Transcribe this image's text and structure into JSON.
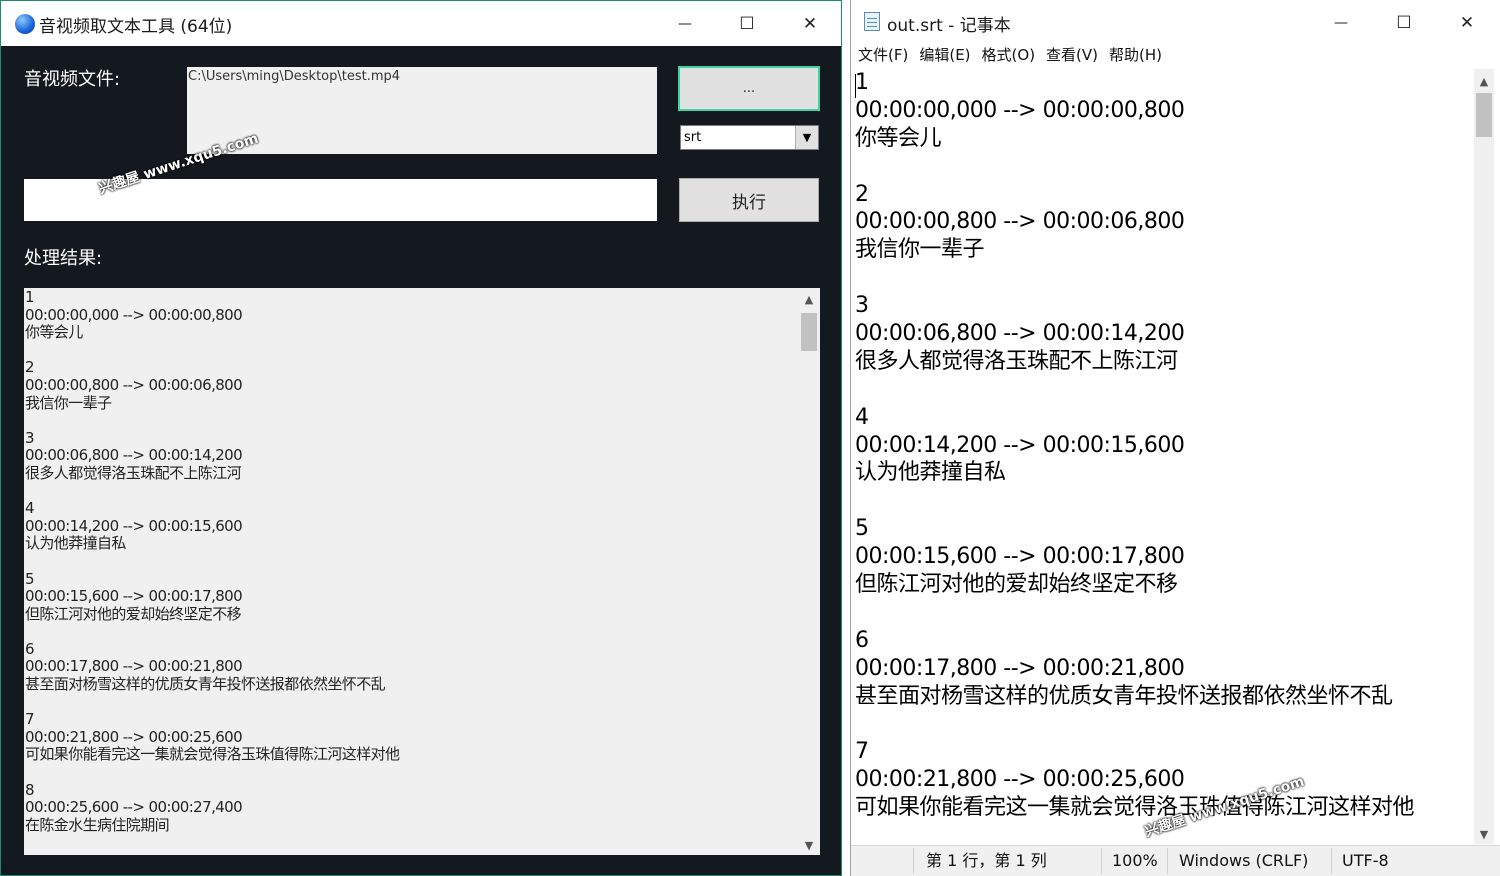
{
  "left_window": {
    "title": "音视频取文本工具 (64位)",
    "file_label": "音视频文件:",
    "file_path": "C:\\Users\\ming\\Desktop\\test.mp4",
    "browse_label": "...",
    "format_value": "srt",
    "output_path": "",
    "run_label": "执行",
    "result_label": "处理结果:",
    "result_lines": [
      "1",
      "00:00:00,000 --> 00:00:00,800",
      "你等会儿",
      "",
      "2",
      "00:00:00,800 --> 00:00:06,800",
      "我信你一辈子",
      "",
      "3",
      "00:00:06,800 --> 00:00:14,200",
      "很多人都觉得洛玉珠配不上陈江河",
      "",
      "4",
      "00:00:14,200 --> 00:00:15,600",
      "认为他莽撞自私",
      "",
      "5",
      "00:00:15,600 --> 00:00:17,800",
      "但陈江河对他的爱却始终坚定不移",
      "",
      "6",
      "00:00:17,800 --> 00:00:21,800",
      "甚至面对杨雪这样的优质女青年投怀送报都依然坐怀不乱",
      "",
      "7",
      "00:00:21,800 --> 00:00:25,600",
      "可如果你能看完这一集就会觉得洛玉珠值得陈江河这样对他",
      "",
      "8",
      "00:00:25,600 --> 00:00:27,400",
      "在陈金水生病住院期间"
    ]
  },
  "notepad": {
    "title": "out.srt - 记事本",
    "menu": [
      "文件(F)",
      "编辑(E)",
      "格式(O)",
      "查看(V)",
      "帮助(H)"
    ],
    "lines": [
      "1",
      "00:00:00,000 --> 00:00:00,800",
      "你等会儿",
      "",
      "2",
      "00:00:00,800 --> 00:00:06,800",
      "我信你一辈子",
      "",
      "3",
      "00:00:06,800 --> 00:00:14,200",
      "很多人都觉得洛玉珠配不上陈江河",
      "",
      "4",
      "00:00:14,200 --> 00:00:15,600",
      "认为他莽撞自私",
      "",
      "5",
      "00:00:15,600 --> 00:00:17,800",
      "但陈江河对他的爱却始终坚定不移",
      "",
      "6",
      "00:00:17,800 --> 00:00:21,800",
      "甚至面对杨雪这样的优质女青年投怀送报都依然坐怀不乱",
      "",
      "7",
      "00:00:21,800 --> 00:00:25,600",
      "可如果你能看完这一集就会觉得洛玉珠值得陈江河这样对他"
    ],
    "status": {
      "position": "第 1 行，第 1 列",
      "zoom": "100%",
      "line_ending": "Windows (CRLF)",
      "encoding": "UTF-8"
    }
  },
  "watermark": "兴趣屋 www.xqu5.com",
  "window_controls": {
    "minimize": "—",
    "maximize": "☐",
    "close": "✕"
  }
}
